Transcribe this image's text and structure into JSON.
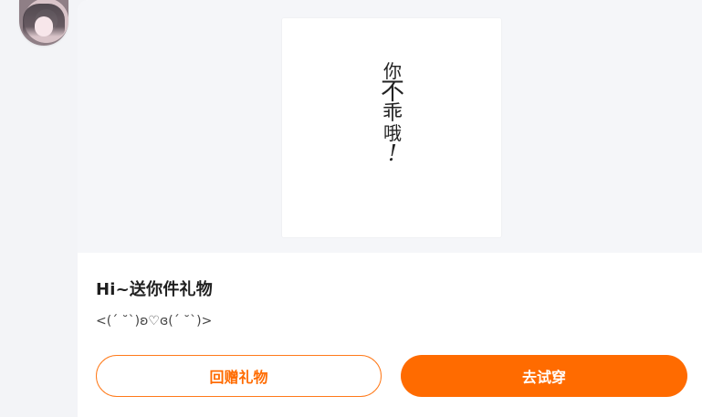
{
  "gift_image": {
    "lines": [
      "你",
      "不",
      "乖",
      "哦",
      "!"
    ]
  },
  "message": {
    "title": "Hi~送你件礼物",
    "subtitle": "<(´ ˘`)ʚ♡ɞ(´ ˘`)>"
  },
  "actions": {
    "return_gift_label": "回赠礼物",
    "try_on_label": "去试穿"
  },
  "colors": {
    "accent": "#ff6b00",
    "page_bg": "#f3f4f7",
    "card_bg": "#ffffff",
    "preview_bg": "#f5f6f9"
  }
}
